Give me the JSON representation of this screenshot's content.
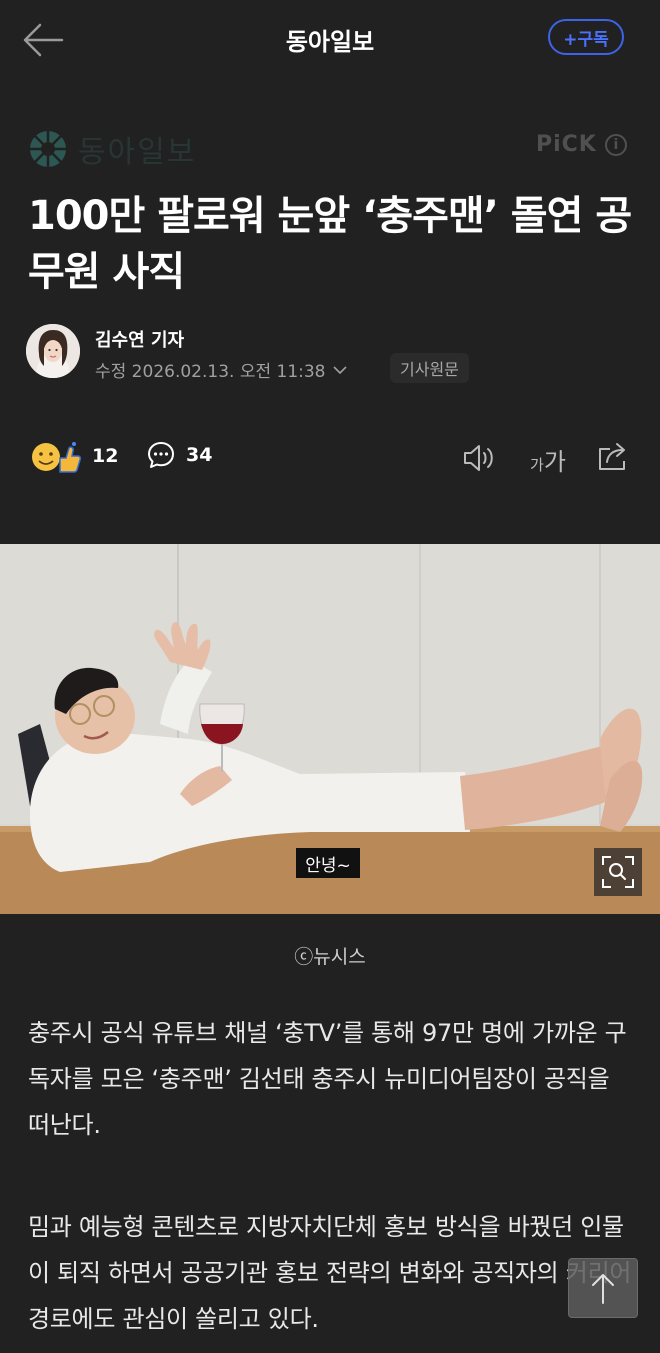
{
  "header": {
    "press_name": "동아일보",
    "subscribe_label": "+구독"
  },
  "press_logo": {
    "text": "동아일보"
  },
  "pick": {
    "label": "PiCK",
    "info_icon": "i"
  },
  "article": {
    "headline": "100만 팔로워 눈앞 ‘충주맨’ 돌연 공무원 사직",
    "reporter": "김수연 기자",
    "updated": "수정 2026.02.13. 오전 11:38",
    "original_label": "기사원문",
    "reaction_count": "12",
    "comment_count": "34",
    "font_size_small": "가",
    "font_size_large": "가"
  },
  "photo": {
    "subtitle": "안녕~",
    "credit": "ⓒ뉴시스"
  },
  "body": {
    "paragraphs": [
      "충주시 공식 유튜브 채널 ‘충TV’를 통해 97만 명에 가까운 구독자를 모은 ‘충주맨’ 김선태 충주시 뉴미디어팀장이 공직을 떠난다.",
      "밈과 예능형 콘텐츠로 지방자치단체 홍보 방식을 바꿨던 인물이 퇴직 하면서 공공기관 홍보 전략의 변화와 공직자의 커리어 경로에도 관심이 쏠리고 있다."
    ]
  },
  "icons": {
    "back": "arrow-left-icon",
    "info": "info-icon",
    "chevron": "chevron-down-icon",
    "reaction": "reaction-emoji-icon",
    "comment": "comment-bubble-icon",
    "tts": "speaker-icon",
    "share": "share-icon",
    "zoom": "zoom-search-icon",
    "top": "arrow-up-icon"
  },
  "colors": {
    "background": "#212121",
    "accent": "#3d63e8"
  }
}
